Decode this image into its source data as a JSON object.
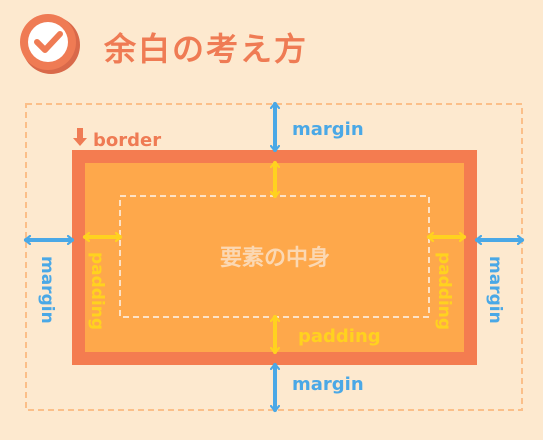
{
  "header": {
    "title": "余白の考え方",
    "icon": "check-circle-icon"
  },
  "diagram": {
    "border_label": "border",
    "margin_label": "margin",
    "padding_label": "padding",
    "content_label": "要素の中身"
  },
  "colors": {
    "background": "#fde9cf",
    "accent": "#ef7b54",
    "border_box": "#f47c50",
    "padding_box": "#fea84b",
    "margin_arrow": "#4aa8e6",
    "padding_arrow": "#ffd21f",
    "content_text": "#fbd8b3"
  }
}
